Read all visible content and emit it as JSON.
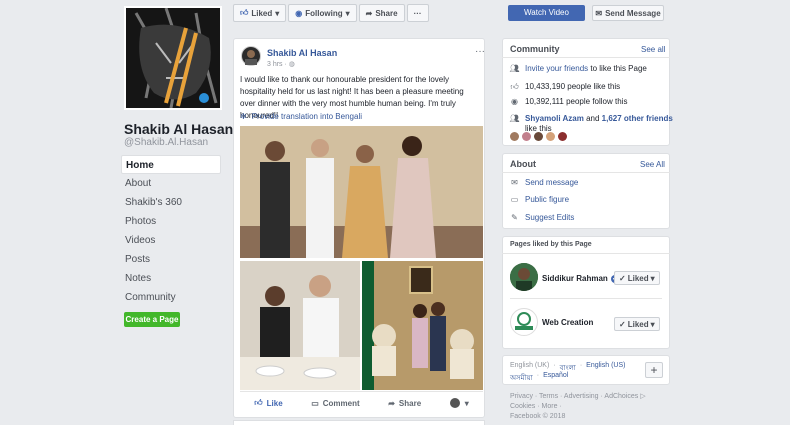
{
  "page": {
    "name": "Shakib Al Hasan",
    "handle": "@Shakib.Al.Hasan"
  },
  "nav": [
    "Home",
    "About",
    "Shakib's 360",
    "Photos",
    "Videos",
    "Posts",
    "Notes",
    "Community"
  ],
  "create_page_label": "Create a Page",
  "actionbar": {
    "liked": "Liked",
    "following": "Following",
    "share": "Share",
    "more": "···",
    "watch_video": "Watch Video",
    "send_message": "Send Message"
  },
  "post": {
    "author": "Shakib Al Hasan",
    "time": "3 hrs",
    "menu": "···",
    "text": "I would like to thank our honourable president for the lovely hospitality held for us last night! It has been a pleasure meeting over dinner with the very most humble human being. I'm truly honoured!!",
    "translate": "Provide translation into Bengali",
    "actions": [
      "Like",
      "Comment",
      "Share"
    ]
  },
  "community": {
    "title": "Community",
    "see_all": "See all",
    "invite": "Invite your friends",
    "invite_rest": "to like this Page",
    "likes": "10,433,190 people like this",
    "follows": "10,392,111 people follow this",
    "friends_name": "Shyamoli Azam",
    "friends_and": "and",
    "friends_others": "1,627 other friends",
    "friends_rest": "like this"
  },
  "about": {
    "title": "About",
    "see_all": "See All",
    "send_message": "Send message",
    "category": "Public figure",
    "suggest": "Suggest Edits"
  },
  "pages_liked": {
    "title": "Pages liked by this Page",
    "items": [
      {
        "name": "Siddikur Rahman",
        "button": "Liked"
      },
      {
        "name": "Web Creation",
        "button": "Liked"
      }
    ]
  },
  "languages": {
    "line1": [
      "English (UK)",
      "বাংলা",
      "English (US)"
    ],
    "line2": [
      "অসমীয়া",
      "Español"
    ],
    "add": "+"
  },
  "footer": {
    "line1": "Privacy · Terms · Advertising · AdChoices ▷",
    "line2": "Cookies · More ·",
    "line3": "Facebook © 2018"
  },
  "icons": {
    "thumb": "thumbs-up-icon",
    "rss": "rss-icon",
    "share": "share-arrow-icon",
    "messenger": "messenger-icon"
  },
  "colors": {
    "brand": "#4267b2",
    "link": "#365899",
    "green": "#42b72a",
    "background": "#e9ebee"
  }
}
